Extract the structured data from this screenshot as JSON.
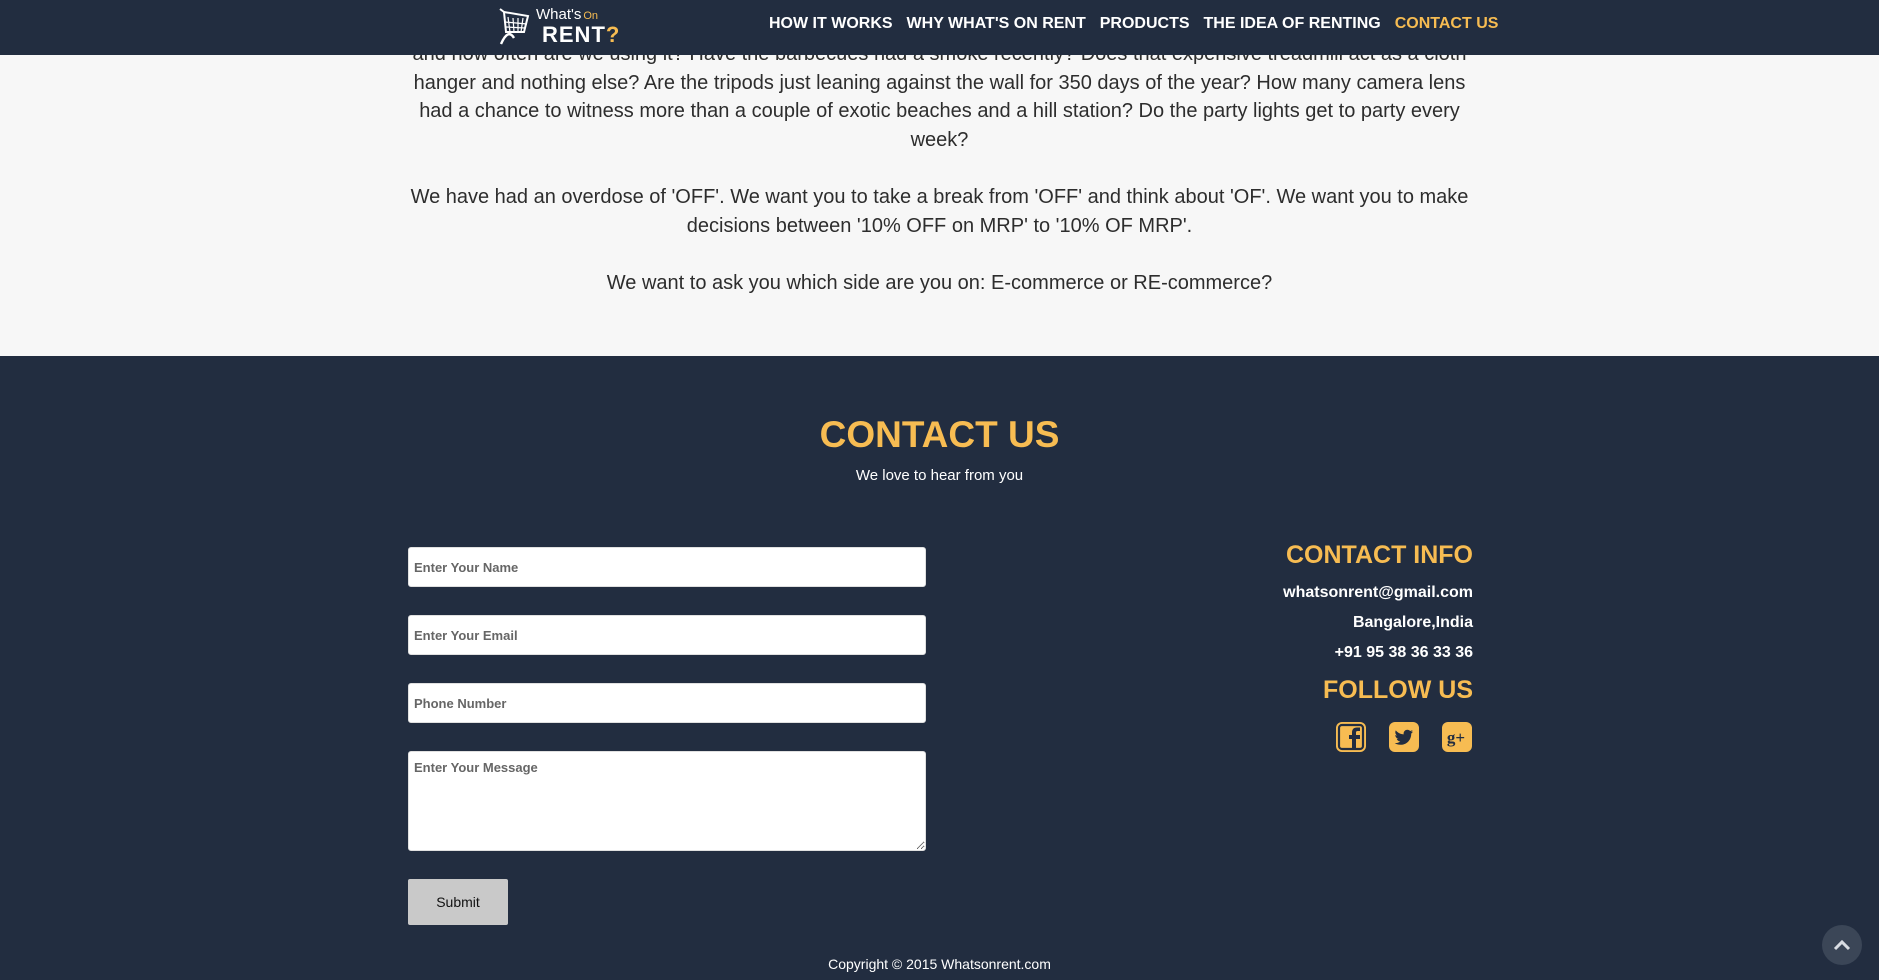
{
  "brand": {
    "logo_line1": "What's",
    "logo_on": "On",
    "logo_line2": "RENT",
    "logo_q": "?"
  },
  "nav": {
    "items": [
      {
        "label": "HOW IT WORKS"
      },
      {
        "label": "WHY WHAT'S ON RENT"
      },
      {
        "label": "PRODUCTS"
      },
      {
        "label": "THE IDEA OF RENTING"
      },
      {
        "label": "CONTACT US",
        "active": true
      }
    ]
  },
  "about": {
    "paragraph1": "and how often are we using it? Have the barbecues had a smoke recently? Does that expensive treadmill act as a cloth hanger and nothing else? Are the tripods just leaning against the wall for 350 days of the year? How many camera lens had a chance to witness more than a couple of exotic beaches and a hill station? Do the party lights get to party every week?",
    "paragraph2": "We have had an overdose of 'OFF'. We want you to take a break from 'OFF' and think about 'OF'. We want you to make decisions between '10% OFF on MRP' to '10% OF MRP'.",
    "paragraph3": "We want to ask you which side are you on: E-commerce or RE-commerce?"
  },
  "contact": {
    "title": "CONTACT US",
    "subtitle": "We love to hear from you",
    "form": {
      "name_placeholder": "Enter Your Name",
      "email_placeholder": "Enter Your Email",
      "phone_placeholder": "Phone Number",
      "message_placeholder": "Enter Your Message",
      "submit_label": "Submit"
    },
    "info": {
      "title": "CONTACT INFO",
      "email": "whatsonrent@gmail.com",
      "location": "Bangalore,India",
      "phone": "+91 95 38 36 33 36"
    },
    "follow": {
      "title": "FOLLOW US",
      "icons": [
        "facebook-icon",
        "twitter-icon",
        "google-plus-icon"
      ]
    }
  },
  "footer": {
    "copyright": "Copyright © 2015 Whatsonrent.com"
  },
  "colors": {
    "dark_navy": "#222d40",
    "accent_yellow": "#f7bc52",
    "light_bg": "#f7f7f7"
  }
}
